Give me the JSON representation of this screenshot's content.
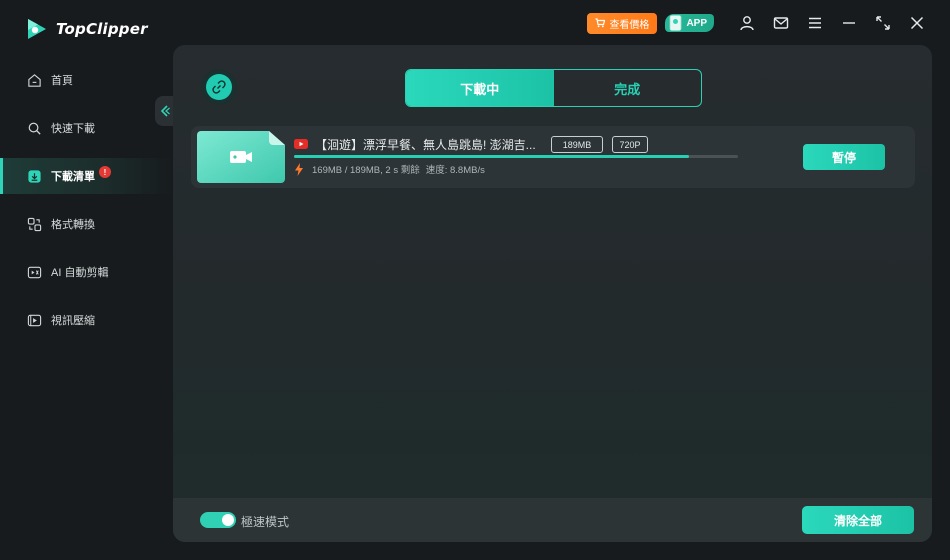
{
  "app": {
    "name": "TopClipper",
    "logo_icon": "topclipper-logo-icon"
  },
  "titlebar": {
    "pricing_label": "查看價格",
    "pricing_icon": "cart-icon",
    "app_label": "APP",
    "app_icon": "phone-app-icon",
    "icons": [
      "user-icon",
      "mail-icon",
      "menu-icon",
      "minimize-icon",
      "maximize-icon",
      "close-icon"
    ]
  },
  "sidebar": {
    "items": [
      {
        "label": "首頁",
        "icon": "home-icon"
      },
      {
        "label": "快速下載",
        "icon": "search-icon"
      },
      {
        "label": "下載清單",
        "icon": "download-list-icon",
        "badge": "!"
      },
      {
        "label": "格式轉換",
        "icon": "convert-icon"
      },
      {
        "label": "AI 自動剪輯",
        "icon": "ai-edit-icon"
      },
      {
        "label": "視訊壓縮",
        "icon": "compress-icon"
      }
    ],
    "active_index": 2
  },
  "main": {
    "tabs": [
      {
        "label": "下載中",
        "active": true
      },
      {
        "label": "完成",
        "active": false
      }
    ],
    "downloads": [
      {
        "source_icon": "youtube-icon",
        "title": "【洄遊】漂浮早餐、無人島跳島! 澎湖吉...",
        "size_tag": "189MB",
        "quality_tag": "720P",
        "progress": 0.89,
        "stats": "169MB / 189MB, 2 s 剩餘",
        "speed": "速度: 8.8MB/s",
        "pause_label": "暫停"
      }
    ]
  },
  "footer": {
    "toggle_label": "極速模式",
    "toggle_on": true,
    "clear_label": "清除全部"
  },
  "colors": {
    "accent": "#2fd0b4",
    "pricing": "#ff8a2a",
    "badge": "#e53935",
    "background": "#171b1d",
    "panel": "#262c2f"
  }
}
